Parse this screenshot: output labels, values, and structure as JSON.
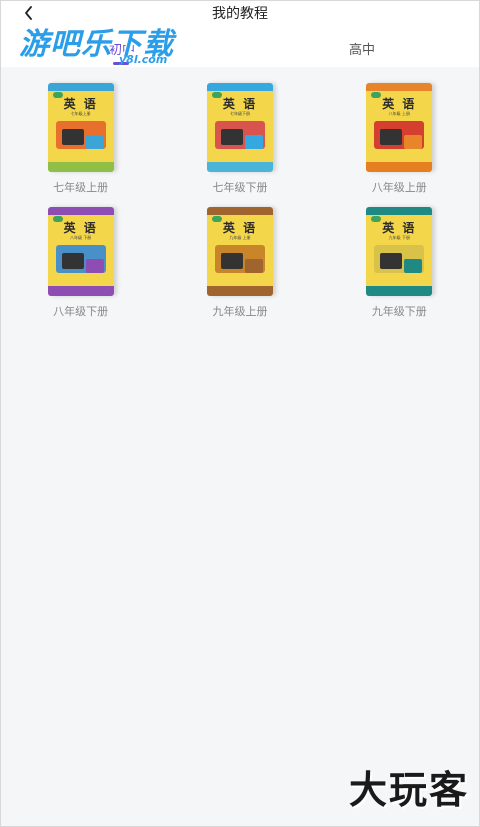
{
  "header": {
    "back_icon": "chevron-left-icon",
    "title": "我的教程"
  },
  "tabs": [
    {
      "label": "初中",
      "active": true
    },
    {
      "label": "高中",
      "active": false
    }
  ],
  "watermark": {
    "main": "游吧乐下载",
    "sub": "y8l.com",
    "bottom": "大玩客"
  },
  "books": [
    {
      "label": "七年级上册",
      "cover_title": "英 语",
      "cover_sub": "七年级上册",
      "band": "#3aa5d6",
      "art": "#e86f2c",
      "foot": "#8fbf47"
    },
    {
      "label": "七年级下册",
      "cover_title": "英 语",
      "cover_sub": "七年级下册",
      "band": "#36a8e0",
      "art": "#d9534f",
      "foot": "#4cb4d8"
    },
    {
      "label": "八年级上册",
      "cover_title": "英 语",
      "cover_sub": "八年级 上册",
      "band": "#e8842a",
      "art": "#d43f2f",
      "foot": "#e67e22"
    },
    {
      "label": "八年级下册",
      "cover_title": "英 语",
      "cover_sub": "八年级 下册",
      "band": "#8d4db3",
      "art": "#4a90c8",
      "foot": "#8d4db3"
    },
    {
      "label": "九年级上册",
      "cover_title": "英 语",
      "cover_sub": "九年级 上册",
      "band": "#a0642f",
      "art": "#c9852a",
      "foot": "#a0642f"
    },
    {
      "label": "九年级下册",
      "cover_title": "英 语",
      "cover_sub": "九年级 下册",
      "band": "#1f8a83",
      "art": "#d8c24a",
      "foot": "#1f8a83"
    }
  ],
  "colors": {
    "accent": "#6a4fd8",
    "background": "#f5f6f8"
  }
}
